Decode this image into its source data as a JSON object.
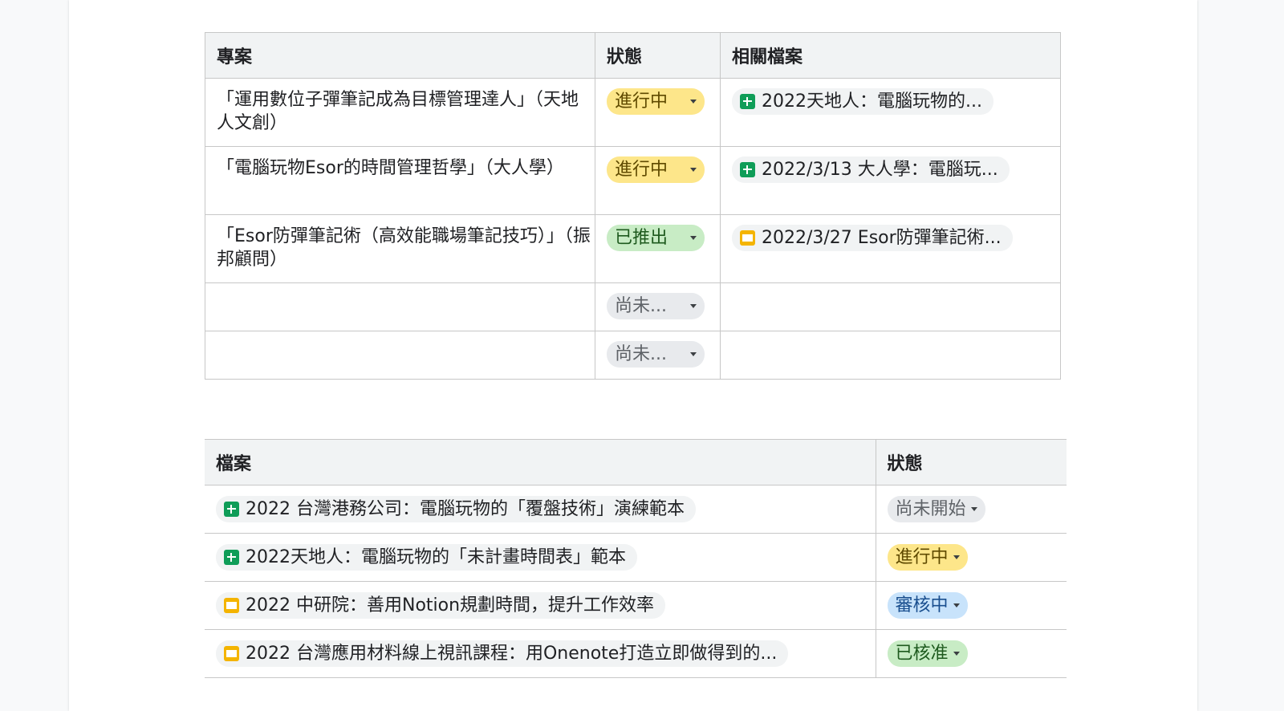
{
  "projects_table": {
    "headers": [
      "專案",
      "狀態",
      "相關檔案"
    ],
    "rows": [
      {
        "project": "「運用數位子彈筆記成為目標管理達人」（天地人文創）",
        "status": "進行中",
        "status_kind": "in-progress",
        "file": "2022天地人：電腦玩物的...",
        "file_type": "sheets-icon"
      },
      {
        "project": "「電腦玩物Esor的時間管理哲學」（大人學）",
        "status": "進行中",
        "status_kind": "in-progress",
        "file": "2022/3/13 大人學：電腦玩...",
        "file_type": "sheets-icon"
      },
      {
        "project": "「Esor防彈筆記術（高效能職場筆記技巧）」（振邦顧問）",
        "status": "已推出",
        "status_kind": "launched",
        "file": "2022/3/27 Esor防彈筆記術...",
        "file_type": "slides-icon"
      },
      {
        "project": "",
        "status": "尚未...",
        "status_kind": "not-started",
        "file": "",
        "file_type": ""
      },
      {
        "project": "",
        "status": "尚未...",
        "status_kind": "not-started",
        "file": "",
        "file_type": ""
      }
    ]
  },
  "files_table": {
    "headers": [
      "檔案",
      "狀態"
    ],
    "rows": [
      {
        "file": "2022 台灣港務公司：電腦玩物的「覆盤技術」演練範本",
        "file_type": "sheets-icon",
        "status": "尚未開始",
        "status_kind": "not-started"
      },
      {
        "file": "2022天地人：電腦玩物的「未計畫時間表」範本",
        "file_type": "sheets-icon",
        "status": "進行中",
        "status_kind": "in-progress"
      },
      {
        "file": "2022 中研院：善用Notion規劃時間，提升工作效率",
        "file_type": "slides-icon",
        "status": "審核中",
        "status_kind": "review"
      },
      {
        "file": "2022 台灣應用材料線上視訊課程：用Onenote打造立即做得到的...",
        "file_type": "slides-icon",
        "status": "已核准",
        "status_kind": "approved"
      }
    ]
  },
  "colors": {
    "in_progress": "#fde68a",
    "launched": "#c8ecc5",
    "not_started": "#e8eaed",
    "review": "#c8e3fb",
    "approved": "#c8ecc5",
    "sheets": "#0f9d58",
    "slides": "#f4b400"
  }
}
